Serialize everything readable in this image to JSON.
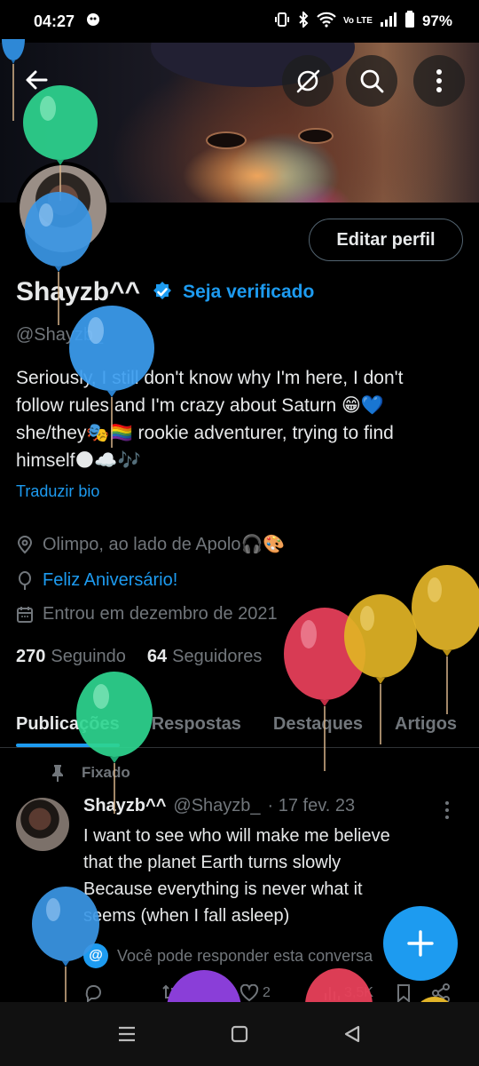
{
  "status_bar": {
    "time": "04:27",
    "battery": "97%",
    "network": "Vo LTE"
  },
  "profile": {
    "name": "Shayzb^^",
    "verify_label": "Seja verificado",
    "handle": "@Shayzb_",
    "bio": "Seriously, I still don't know why I'm here, I don't\nfollow rules and I'm crazy about Saturn 😁💙\nshe/they🎭🏳️‍🌈 rookie adventurer, trying to find\nhimself🌑☁️🎶",
    "translate_label": "Traduzir bio",
    "location": "Olimpo, ao lado de Apolo🎧🎨",
    "birthday": "Feliz Aniversário!",
    "joined": "Entrou em dezembro de 2021",
    "following_count": "270",
    "following_label": "Seguindo",
    "followers_count": "64",
    "followers_label": "Seguidores",
    "edit_button": "Editar perfil"
  },
  "tabs": [
    "Publicações",
    "Respostas",
    "Destaques",
    "Artigos"
  ],
  "pinned_post": {
    "pinned_label": "Fixado",
    "author_name": "Shayzb^^",
    "author_handle": "@Shayzb_",
    "date": "· 17 fev. 23",
    "text": "I want to see who will make me believe\nthat the planet Earth turns slowly\nBecause everything is never what it\nseems (when I fall asleep)",
    "reply_note": "Você pode responder esta conversa",
    "likes": "2",
    "views": "3,5K"
  },
  "colors": {
    "accent": "#1d9bf0",
    "background": "#000000",
    "muted": "#71767b",
    "text": "#e7e9ea"
  },
  "icons": [
    "back-arrow-icon",
    "grok-icon",
    "search-icon",
    "more-vertical-icon",
    "verified-badge-icon",
    "location-icon",
    "balloon-icon",
    "calendar-icon",
    "pin-icon",
    "reply-icon",
    "repost-icon",
    "like-icon",
    "views-icon",
    "bookmark-icon",
    "share-icon",
    "compose-icon"
  ]
}
